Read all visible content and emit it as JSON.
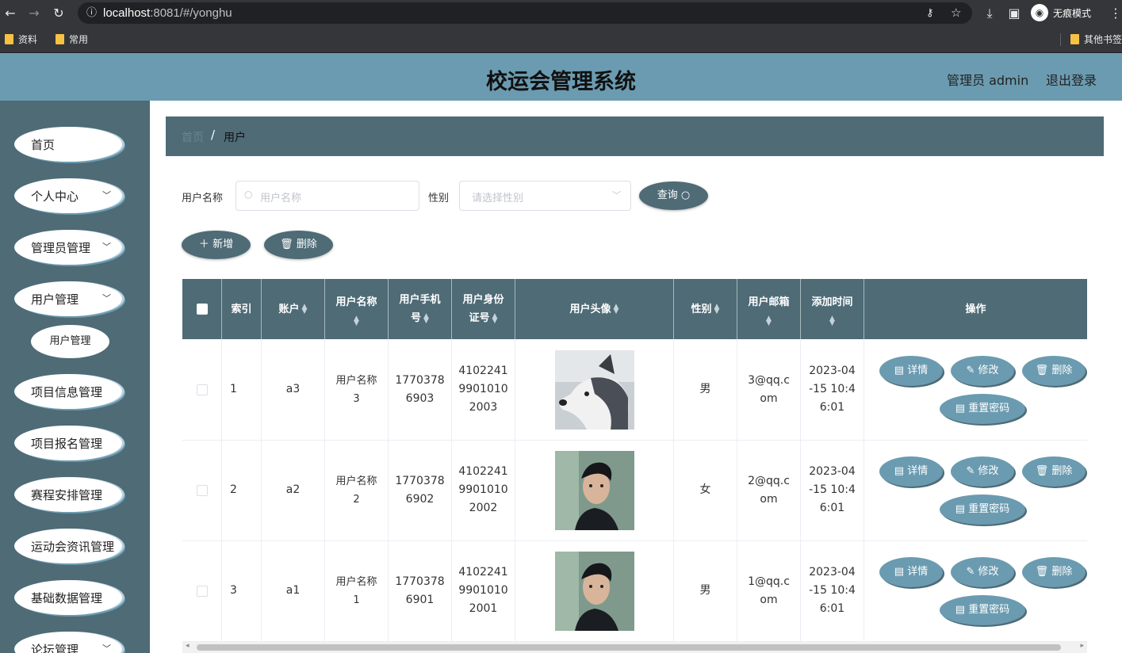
{
  "browser": {
    "url_host": "localhost",
    "url_rest": ":8081/#/yonghu",
    "incognito_label": "无痕模式",
    "bookmarks": [
      "资料",
      "常用"
    ],
    "other_bookmarks": "其他书签"
  },
  "header": {
    "title": "校运会管理系统",
    "admin_label": "管理员 admin",
    "logout": "退出登录"
  },
  "sidebar": {
    "items": [
      {
        "label": "首页",
        "chevron": false
      },
      {
        "label": "个人中心",
        "chevron": true
      },
      {
        "label": "管理员管理",
        "chevron": true
      },
      {
        "label": "用户管理",
        "chevron": true
      },
      {
        "label": "项目信息管理",
        "chevron": true
      },
      {
        "label": "项目报名管理",
        "chevron": true
      },
      {
        "label": "赛程安排管理",
        "chevron": true
      },
      {
        "label": "运动会资讯管理",
        "chevron": true
      },
      {
        "label": "基础数据管理",
        "chevron": true
      },
      {
        "label": "论坛管理",
        "chevron": true
      }
    ],
    "sub_item": "用户管理"
  },
  "breadcrumb": {
    "home": "首页",
    "separator": "/",
    "current": "用户"
  },
  "search": {
    "name_label": "用户名称",
    "name_placeholder": "用户名称",
    "gender_label": "性别",
    "gender_placeholder": "请选择性别",
    "query_button": "查询"
  },
  "actions": {
    "add": "新增",
    "delete": "删除"
  },
  "table": {
    "headers": [
      "索引",
      "账户",
      "用户名称",
      "用户手机号",
      "用户身份证号",
      "用户头像",
      "性别",
      "用户邮箱",
      "添加时间",
      "操作"
    ],
    "header_lines": {
      "name": [
        "用户名称"
      ],
      "phone": [
        "用户手机",
        "号"
      ],
      "idcard": [
        "用户身份",
        "证号"
      ],
      "email": [
        "用户邮箱"
      ],
      "time": [
        "添加时间"
      ]
    },
    "rows": [
      {
        "index": "1",
        "account": "a3",
        "name": [
          "用户名称",
          "3"
        ],
        "phone": [
          "1770378",
          "6903"
        ],
        "idcard": [
          "4102241",
          "9901010",
          "2003"
        ],
        "avatar": "husky-dog-photo",
        "gender": "男",
        "email": [
          "3@qq.c",
          "om"
        ],
        "time": [
          "2023-04",
          "-15 10:4",
          "6:01"
        ]
      },
      {
        "index": "2",
        "account": "a2",
        "name": [
          "用户名称",
          "2"
        ],
        "phone": [
          "1770378",
          "6902"
        ],
        "idcard": [
          "4102241",
          "9901010",
          "2002"
        ],
        "avatar": "man-portrait-photo",
        "gender": "女",
        "email": [
          "2@qq.c",
          "om"
        ],
        "time": [
          "2023-04",
          "-15 10:4",
          "6:01"
        ]
      },
      {
        "index": "3",
        "account": "a1",
        "name": [
          "用户名称",
          "1"
        ],
        "phone": [
          "1770378",
          "6901"
        ],
        "idcard": [
          "4102241",
          "9901010",
          "2001"
        ],
        "avatar": "man-portrait-photo",
        "gender": "男",
        "email": [
          "1@qq.c",
          "om"
        ],
        "time": [
          "2023-04",
          "-15 10:4",
          "6:01"
        ]
      }
    ],
    "op_buttons": {
      "detail": "详情",
      "edit": "修改",
      "delete": "删除",
      "reset": "重置密码"
    }
  },
  "colors": {
    "primary": "#4e6b76",
    "accent": "#6b9bb0"
  }
}
